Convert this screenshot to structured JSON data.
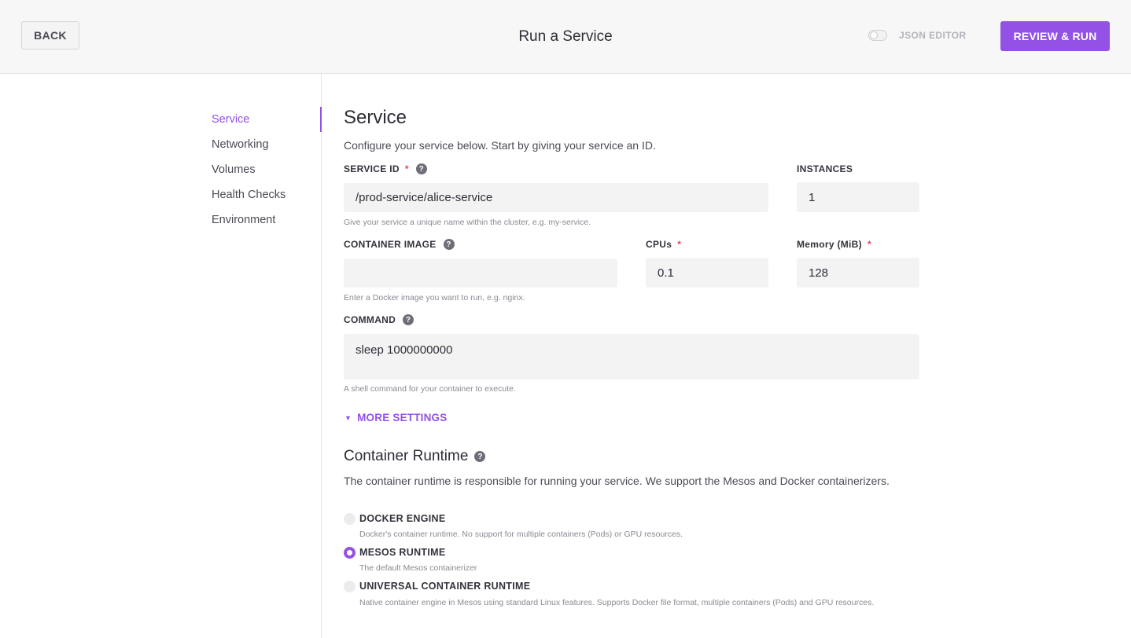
{
  "header": {
    "back_label": "BACK",
    "title": "Run a Service",
    "json_editor_label": "JSON EDITOR",
    "json_editor_enabled": false,
    "review_label": "REVIEW & RUN"
  },
  "sidebar": {
    "items": [
      {
        "label": "Service",
        "active": true
      },
      {
        "label": "Networking",
        "active": false
      },
      {
        "label": "Volumes",
        "active": false
      },
      {
        "label": "Health Checks",
        "active": false
      },
      {
        "label": "Environment",
        "active": false
      }
    ]
  },
  "service": {
    "heading": "Service",
    "description": "Configure your service below. Start by giving your service an ID.",
    "service_id": {
      "label": "SERVICE ID",
      "required": "*",
      "value": "/prod-service/alice-service",
      "hint": "Give your service a unique name within the cluster, e.g. my-service."
    },
    "instances": {
      "label": "INSTANCES",
      "value": "1"
    },
    "container_image": {
      "label": "CONTAINER IMAGE",
      "value": "",
      "hint": "Enter a Docker image you want to run, e.g. nginx."
    },
    "cpus": {
      "label": "CPUs",
      "required": "*",
      "value": "0.1"
    },
    "memory": {
      "label": "Memory (MiB)",
      "required": "*",
      "value": "128"
    },
    "command": {
      "label": "COMMAND",
      "value": "sleep 1000000000",
      "hint": "A shell command for your container to execute."
    },
    "more_settings": "MORE SETTINGS"
  },
  "runtime": {
    "heading": "Container Runtime",
    "description": "The container runtime is responsible for running your service. We support the Mesos and Docker containerizers.",
    "options": [
      {
        "title": "DOCKER ENGINE",
        "desc": "Docker's container runtime. No support for multiple containers (Pods) or GPU resources.",
        "selected": false
      },
      {
        "title": "MESOS RUNTIME",
        "desc": "The default Mesos containerizer",
        "selected": true
      },
      {
        "title": "UNIVERSAL CONTAINER RUNTIME",
        "desc": "Native container engine in Mesos using standard Linux features. Supports Docker file format, multiple containers (Pods) and GPU resources.",
        "selected": false
      }
    ]
  },
  "colors": {
    "accent": "#9351e5",
    "required": "#e5445c"
  },
  "icons": {
    "help": "question-circle-icon",
    "caret": "caret-down-icon"
  }
}
